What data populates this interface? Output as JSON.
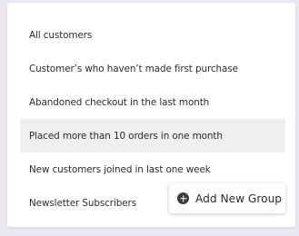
{
  "groups": {
    "items": [
      {
        "label": "All customers",
        "selected": false
      },
      {
        "label": "Customer’s who haven’t made first purchase",
        "selected": false
      },
      {
        "label": "Abandoned checkout in the last month",
        "selected": false
      },
      {
        "label": "Placed more than 10 orders in one month",
        "selected": true
      },
      {
        "label": "New customers joined in last one week",
        "selected": false
      },
      {
        "label": "Newsletter Subscribers",
        "selected": false
      }
    ]
  },
  "actions": {
    "add_group_label": "Add New Group",
    "add_group_icon": "plus-circle-icon"
  },
  "colors": {
    "background": "#ebe7f1",
    "panel": "#ffffff",
    "selected_row": "#efefef",
    "text": "#2b2b2b"
  }
}
